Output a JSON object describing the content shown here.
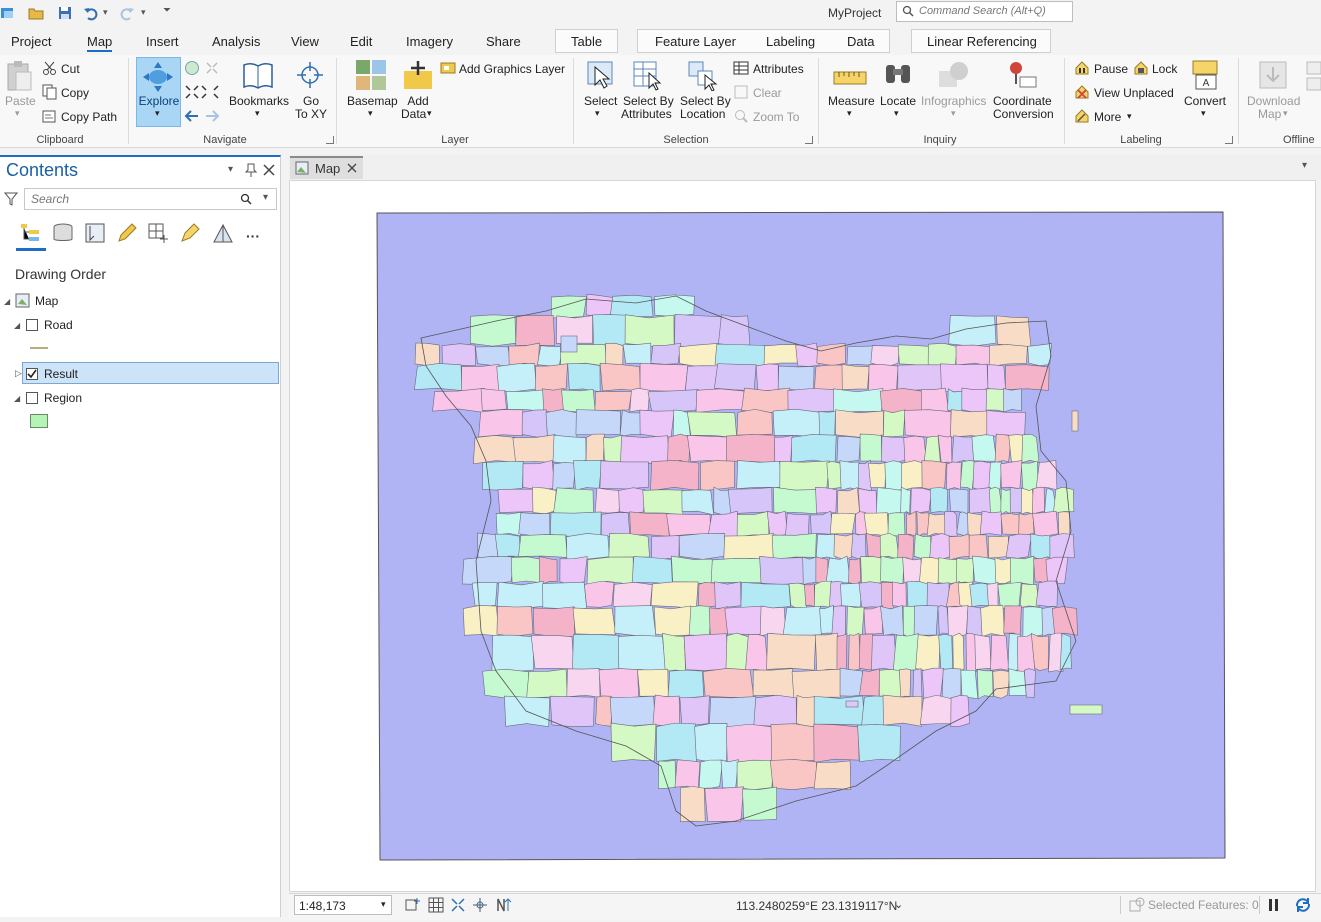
{
  "app": {
    "project_title": "MyProject",
    "command_search_placeholder": "Command Search (Alt+Q)"
  },
  "tabs": [
    {
      "label": "Project",
      "active": false
    },
    {
      "label": "Map",
      "active": true
    },
    {
      "label": "Insert",
      "active": false
    },
    {
      "label": "Analysis",
      "active": false
    },
    {
      "label": "View",
      "active": false
    },
    {
      "label": "Edit",
      "active": false
    },
    {
      "label": "Imagery",
      "active": false
    },
    {
      "label": "Share",
      "active": false
    }
  ],
  "context_tabs": {
    "table": "Table",
    "feature_layer": "Feature Layer",
    "labeling": "Labeling",
    "data": "Data",
    "linear_referencing": "Linear Referencing"
  },
  "ribbon": {
    "clipboard": {
      "group": "Clipboard",
      "paste": "Paste",
      "cut": "Cut",
      "copy": "Copy",
      "copy_path": "Copy Path"
    },
    "navigate": {
      "group": "Navigate",
      "explore": "Explore",
      "bookmarks": "Bookmarks",
      "go_to_xy_1": "Go",
      "go_to_xy_2": "To XY"
    },
    "layer": {
      "group": "Layer",
      "basemap": "Basemap",
      "add_data_1": "Add",
      "add_data_2": "Data",
      "add_graphics_layer": "Add Graphics Layer"
    },
    "selection": {
      "group": "Selection",
      "select": "Select",
      "select_by_attr_1": "Select By",
      "select_by_attr_2": "Attributes",
      "select_by_loc_1": "Select By",
      "select_by_loc_2": "Location",
      "attributes": "Attributes",
      "clear": "Clear",
      "zoom_to": "Zoom To"
    },
    "inquiry": {
      "group": "Inquiry",
      "measure": "Measure",
      "locate": "Locate",
      "infographics": "Infographics",
      "coord_conv_1": "Coordinate",
      "coord_conv_2": "Conversion"
    },
    "labeling": {
      "group": "Labeling",
      "pause": "Pause",
      "lock": "Lock",
      "view_unplaced": "View Unplaced",
      "more": "More",
      "convert": "Convert"
    },
    "offline": {
      "group": "Offline",
      "download_map_1": "Download",
      "download_map_2": "Map"
    }
  },
  "contents": {
    "title": "Contents",
    "search_placeholder": "Search",
    "drawing_order": "Drawing Order",
    "layers": [
      {
        "name": "Map",
        "checked": null
      },
      {
        "name": "Road",
        "checked": false
      },
      {
        "name": "Result",
        "checked": true,
        "selected": true
      },
      {
        "name": "Region",
        "checked": false
      }
    ],
    "region_swatch_color": "#b3f5b3",
    "road_symbol_color": "#b8b07a"
  },
  "map_view": {
    "tab_label": "Map",
    "background_color": "#b0b4f5",
    "scale": "1:48,173",
    "coordinates": "113.2480259°E 23.1319117°N",
    "selected_features": "Selected Features: 0"
  },
  "palette": [
    "#f9c5c5",
    "#c5f0f9",
    "#d6c5f9",
    "#f9d6f0",
    "#c5f9d0",
    "#f9f0c5",
    "#e0c5f9",
    "#c5d8f9",
    "#f9c5e8",
    "#d4f9c5",
    "#f9dcc5",
    "#c5f9f0",
    "#ecc5f9",
    "#f5b3c9",
    "#b3e8f5"
  ]
}
